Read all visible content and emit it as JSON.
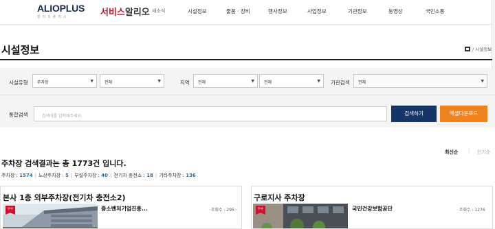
{
  "header": {
    "logo_main_a": "ALIO",
    "logo_main_b": "PLUS",
    "logo_sub": "알리오플러스",
    "brand_a": "서비스",
    "brand_b": "알리오",
    "brand_tag": "새소식",
    "nav": [
      "시설정보",
      "물품 · 장비",
      "행사정보",
      "사업정보",
      "기관정보",
      "동영상",
      "국민소통"
    ]
  },
  "page": {
    "title": "시설정보",
    "breadcrumb": "/ 시설정보"
  },
  "filters": {
    "type_label": "시설유형",
    "type_value": "주차장",
    "type_sub_value": "전체",
    "region_label": "지역",
    "region_value": "전체",
    "region_sub_value": "전체",
    "org_label": "기관검색",
    "org_value": "전체",
    "search_label": "통합검색",
    "search_placeholder": "검색어를 입력해주세요.",
    "search_button": "검색하기",
    "excel_button": "엑셀다운로드"
  },
  "sort": {
    "newest": "최신순",
    "separator": "|",
    "popular": "인기순"
  },
  "results": {
    "summary": "주차장 검색결과는 총 1773건 입니다.",
    "stats": [
      {
        "label": "주차장 :",
        "value": "1574"
      },
      {
        "label": "노상주차장 :",
        "value": "5"
      },
      {
        "label": "부설주차장 :",
        "value": "40"
      },
      {
        "label": "전기차 충전소 :",
        "value": "18"
      },
      {
        "label": "기타주차장 :",
        "value": "136"
      }
    ]
  },
  "cards": [
    {
      "title": "본사 1층 외부주차장(전기차 충전소2)",
      "badge": "우수",
      "org": "중소벤처기업진흥...",
      "views": "조회수 : 295"
    },
    {
      "title": "구로지사 주차장",
      "badge": "우수",
      "org": "국민건강보험공단",
      "views": "조회수 : 1276"
    }
  ],
  "colors": {
    "brand_red": "#d0112b",
    "search_button": "#153566",
    "excel_button": "#f0821e",
    "stat_number": "#1e6fb5"
  }
}
